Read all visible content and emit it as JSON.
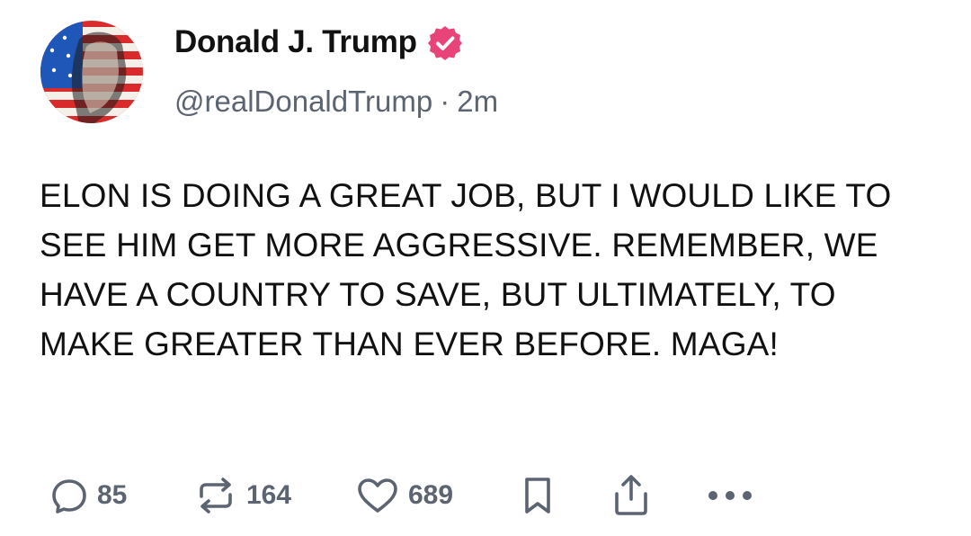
{
  "post": {
    "author": {
      "display_name": "Donald J. Trump",
      "handle": "@realDonaldTrump",
      "separator": "·",
      "time_ago": "2m",
      "verified": true,
      "verified_badge_color": "#e8447a"
    },
    "text": "ELON IS DOING A GREAT JOB, BUT I WOULD LIKE TO SEE HIM GET MORE AGGRESSIVE. REMEMBER, WE HAVE A COUNTRY TO SAVE, BUT ULTIMATELY, TO MAKE GREATER THAN EVER BEFORE. MAGA!",
    "actions": {
      "reply": {
        "icon": "reply-icon",
        "count": "85"
      },
      "retruth": {
        "icon": "retruth-icon",
        "count": "164"
      },
      "like": {
        "icon": "heart-icon",
        "count": "689"
      },
      "bookmark": {
        "icon": "bookmark-icon"
      },
      "share": {
        "icon": "share-icon"
      },
      "more": {
        "icon": "more-icon"
      }
    }
  },
  "colors": {
    "text": "#111111",
    "muted": "#5b6470",
    "verified": "#e8447a"
  }
}
